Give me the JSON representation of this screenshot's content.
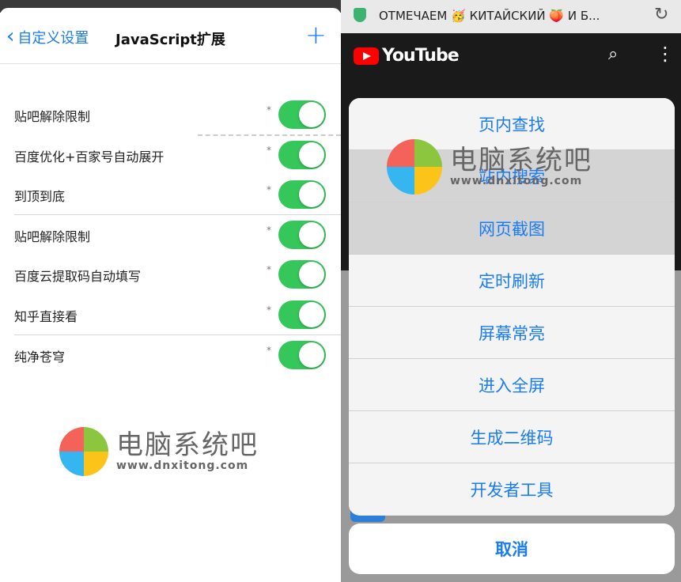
{
  "left": {
    "back_label": "自定义设置",
    "title": "JavaScript扩展",
    "add_icon": "plus-icon",
    "rows": [
      {
        "label": "贴吧解除限制",
        "star": "*",
        "enabled": true
      },
      {
        "label": "百度优化+百家号自动展开",
        "star": "*",
        "enabled": true
      },
      {
        "label": "到顶到底",
        "star": "*",
        "enabled": true
      },
      {
        "label": "贴吧解除限制",
        "star": "*",
        "enabled": true
      },
      {
        "label": "百度云提取码自动填写",
        "star": "*",
        "enabled": true
      },
      {
        "label": "知乎直接看",
        "star": "*",
        "enabled": true
      },
      {
        "label": "纯净苍穹",
        "star": "*",
        "enabled": true
      }
    ]
  },
  "watermark": {
    "name": "电脑系统吧",
    "url": "www.dnxitong.com",
    "colors": [
      "#f4625a",
      "#8cc63f",
      "#36b6f0",
      "#fcc419"
    ]
  },
  "right": {
    "url_text": "ОТМЕЧАЕМ 🥳 КИТАЙСКИЙ 🍑 И Б...",
    "youtube_label": "YouTube",
    "menu_items": [
      "页内查找",
      "站内搜索",
      "网页截图",
      "定时刷新",
      "屏幕常亮",
      "进入全屏",
      "生成二维码",
      "开发者工具"
    ],
    "cancel_label": "取消"
  },
  "colors": {
    "accent": "#1a7cf2",
    "toggle_on": "#35c759",
    "youtube_red": "#ff0000"
  }
}
